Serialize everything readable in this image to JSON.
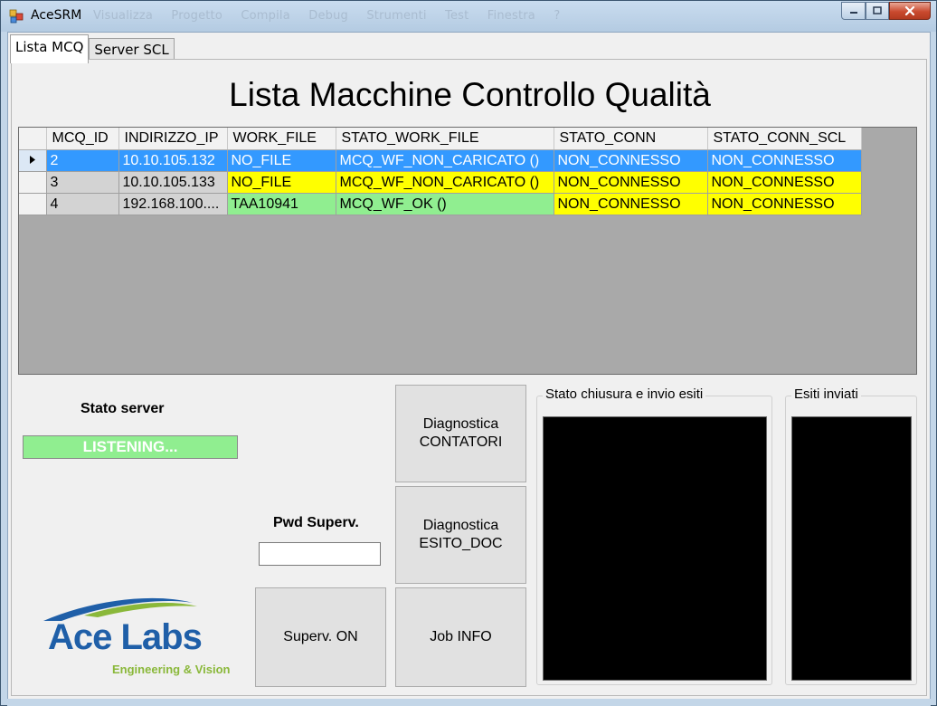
{
  "window": {
    "title": "AceSRM",
    "ghost_menu": [
      "Visualizza",
      "Progetto",
      "Compila",
      "Debug",
      "Strumenti",
      "Test",
      "Finestra",
      "?"
    ]
  },
  "tabs": [
    {
      "label": "Lista MCQ",
      "active": true
    },
    {
      "label": "Server SCL",
      "active": false
    }
  ],
  "page_title": "Lista Macchine Controllo Qualità",
  "grid": {
    "columns": [
      "MCQ_ID",
      "INDIRIZZO_IP",
      "WORK_FILE",
      "STATO_WORK_FILE",
      "STATO_CONN",
      "STATO_CONN_SCL"
    ],
    "rows": [
      [
        "2",
        "10.10.105.132",
        "NO_FILE",
        "MCQ_WF_NON_CARICATO ()",
        "NON_CONNESSO",
        "NON_CONNESSO"
      ],
      [
        "3",
        "10.10.105.133",
        "NO_FILE",
        "MCQ_WF_NON_CARICATO ()",
        "NON_CONNESSO",
        "NON_CONNESSO"
      ],
      [
        "4",
        "192.168.100....",
        "TAA10941",
        "MCQ_WF_OK ()",
        "NON_CONNESSO",
        "NON_CONNESSO"
      ]
    ]
  },
  "server": {
    "label": "Stato server",
    "status": "LISTENING..."
  },
  "supervisor": {
    "pwd_label": "Pwd Superv.",
    "pwd_value": "",
    "on_button": "Superv. ON"
  },
  "buttons": {
    "diag_contatori": "Diagnostica\nCONTATORI",
    "diag_esito_doc": "Diagnostica\nESITO_DOC",
    "job_info": "Job INFO"
  },
  "groups": {
    "stato_chiusura": "Stato chiusura e invio esiti",
    "esiti_inviati": "Esiti inviati"
  },
  "logo": {
    "name": "Ace Labs",
    "tagline": "Engineering & Vision"
  },
  "colors": {
    "selected_row": "#3399ff",
    "warning": "#ffff00",
    "ok": "#90ee90"
  }
}
